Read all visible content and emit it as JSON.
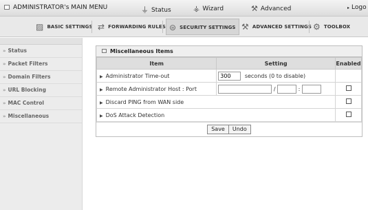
{
  "topbar": {
    "title": "ADMINISTRATOR's MAIN MENU",
    "status_label": "Status",
    "wizard_label": "Wizard",
    "advanced_label": "Advanced",
    "logout_label": "Logo"
  },
  "nav": {
    "basic": "BASIC SETTINGS",
    "forwarding": "FORWARDING RULES",
    "security": "SECURITY SETTINGS",
    "advanced": "ADVANCED SETTINGS",
    "toolbox": "TOOLBOX"
  },
  "sidebar": {
    "items": [
      {
        "label": "Status"
      },
      {
        "label": "Packet Filters"
      },
      {
        "label": "Domain Filters"
      },
      {
        "label": "URL Blocking"
      },
      {
        "label": "MAC Control"
      },
      {
        "label": "Miscellaneous"
      }
    ]
  },
  "panel": {
    "title": "Miscellaneous Items",
    "headers": {
      "item": "Item",
      "setting": "Setting",
      "enabled": "Enabled"
    },
    "rows": [
      {
        "name": "Administrator Time-out",
        "value": "300",
        "hint": "seconds (0 to disable)"
      },
      {
        "name": "Remote Administrator Host : Port",
        "sep_slash": "/",
        "sep_colon": ":"
      },
      {
        "name": "Discard PING from WAN side"
      },
      {
        "name": "DoS Attack Detection"
      }
    ],
    "save_label": "Save",
    "undo_label": "Undo"
  }
}
